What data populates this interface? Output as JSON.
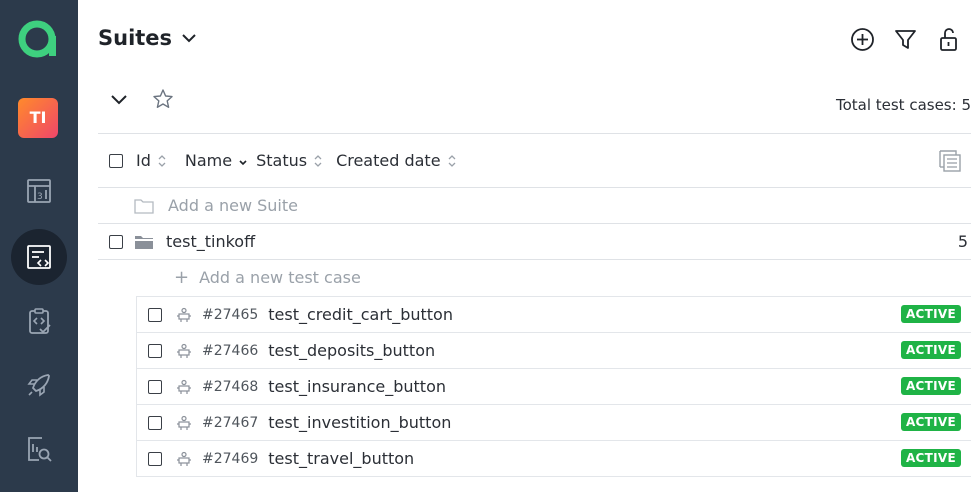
{
  "sidebar": {
    "avatar_initials": "TI",
    "items": [
      {
        "icon": "dashboard-icon",
        "active": false
      },
      {
        "icon": "test-cases-icon",
        "active": true
      },
      {
        "icon": "test-plans-icon",
        "active": false
      },
      {
        "icon": "launches-icon",
        "active": false
      },
      {
        "icon": "analytics-search-icon",
        "active": false
      }
    ]
  },
  "header": {
    "title": "Suites",
    "actions": [
      "add-icon",
      "filter-icon",
      "unlock-icon"
    ]
  },
  "toolbar": {
    "total_label": "Total test cases: 5"
  },
  "columns": [
    {
      "label": "Id",
      "sort": "none"
    },
    {
      "label": "Name",
      "sort": "desc"
    },
    {
      "label": "Status",
      "sort": "none"
    },
    {
      "label": "Created date",
      "sort": "none"
    }
  ],
  "add_suite_label": "Add a new Suite",
  "suite": {
    "name": "test_tinkoff",
    "count": "5"
  },
  "add_case_label": "Add a new test case",
  "cases": [
    {
      "id": "#27465",
      "name": "test_credit_cart_button",
      "status": "ACTIVE"
    },
    {
      "id": "#27466",
      "name": "test_deposits_button",
      "status": "ACTIVE"
    },
    {
      "id": "#27468",
      "name": "test_insurance_button",
      "status": "ACTIVE"
    },
    {
      "id": "#27467",
      "name": "test_investition_button",
      "status": "ACTIVE"
    },
    {
      "id": "#27469",
      "name": "test_travel_button",
      "status": "ACTIVE"
    }
  ],
  "colors": {
    "sidebar_bg": "#2c3a4b",
    "logo_green": "#3ed07f",
    "badge_green": "#1fb346"
  }
}
